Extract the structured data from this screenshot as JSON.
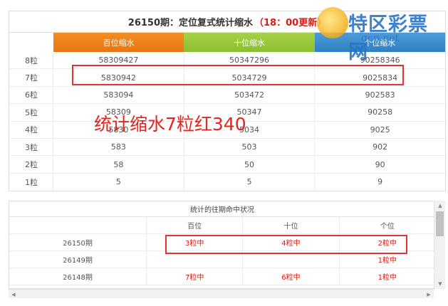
{
  "top_table": {
    "title": "26150期：定位复式统计缩水",
    "update": "（18：00更新）",
    "headers": [
      "百位缩水",
      "十位缩水",
      "个位缩水"
    ],
    "rows": [
      {
        "label": "8粒",
        "values": [
          "58309427",
          "50347296",
          "90258346"
        ]
      },
      {
        "label": "7粒",
        "values": [
          "5830942",
          "5034729",
          "9025834"
        ]
      },
      {
        "label": "6粒",
        "values": [
          "583094",
          "503472",
          "902583"
        ]
      },
      {
        "label": "5粒",
        "values": [
          "58309",
          "50347",
          "90258"
        ]
      },
      {
        "label": "4粒",
        "values": [
          "5830",
          "5034",
          "9025"
        ]
      },
      {
        "label": "3粒",
        "values": [
          "583",
          "503",
          "902"
        ]
      },
      {
        "label": "2粒",
        "values": [
          "58",
          "50",
          "90"
        ]
      },
      {
        "label": "1粒",
        "values": [
          "5",
          "5",
          "9"
        ]
      }
    ]
  },
  "overlay_text": "统计缩水7粒红340",
  "logo": {
    "name": "特区彩票网",
    "url": "qcp.net"
  },
  "bottom_table": {
    "title": "统计的往期命中状况",
    "headers": [
      "",
      "百位",
      "十位",
      "个位"
    ],
    "rows": [
      {
        "period": "26150期",
        "values": [
          "3粒中",
          "4粒中",
          "2粒中"
        ]
      },
      {
        "period": "26149期",
        "values": [
          "",
          "",
          "1粒中"
        ]
      },
      {
        "period": "26148期",
        "values": [
          "7粒中",
          "6粒中",
          "1粒中"
        ]
      }
    ]
  },
  "colors": {
    "accent_red": "#e0190f",
    "orange": "#ea7414",
    "green": "#8cbf2f",
    "blue": "#2f7fc4"
  }
}
